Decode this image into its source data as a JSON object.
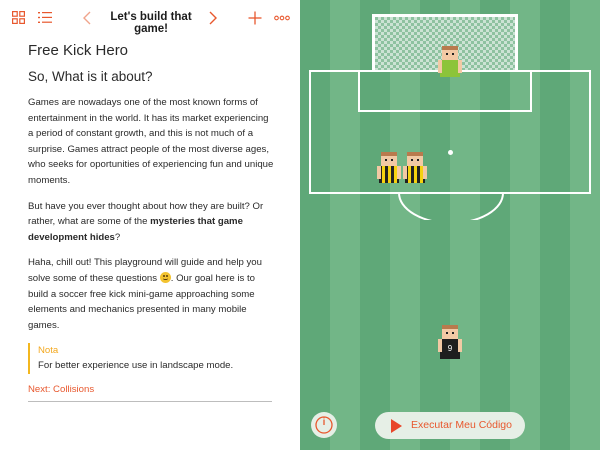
{
  "toolbar": {
    "title": "Let's build that game!",
    "icons": [
      "grid-icon",
      "list-icon",
      "chevron-left-icon",
      "chevron-right-icon",
      "plus-icon",
      "more-icon"
    ],
    "accent": "#e8582e"
  },
  "lesson": {
    "title": "Free Kick Hero",
    "subtitle": "So, What is it about?",
    "para1": "Games are nowadays one of the most known forms of entertainment in the world. It has its market experiencing a period of constant growth, and this is not much of a surprise. Games attract people of the most diverse ages, who seeks for oportunities of experiencing fun and unique moments.",
    "para2_pre": "But have you ever thought about how they are built? Or rather, what are some of the ",
    "para2_bold": "mysteries that game development hides",
    "para2_post": "?",
    "para3_pre": "Haha, chill out! This playground will guide and help you solve some of these questions ",
    "para3_post": ". Our goal here is to build a soccer free kick mini-game approaching some elements and mechanics presented in many mobile games.",
    "note_title": "Nota",
    "note_body": "For better experience use in landscape mode.",
    "next_link": "Next: Collisions"
  },
  "game": {
    "field_color": "#5fa878",
    "stripe_color": "#72b687",
    "run_button_label": "Executar Meu Código",
    "player_number": "9"
  }
}
